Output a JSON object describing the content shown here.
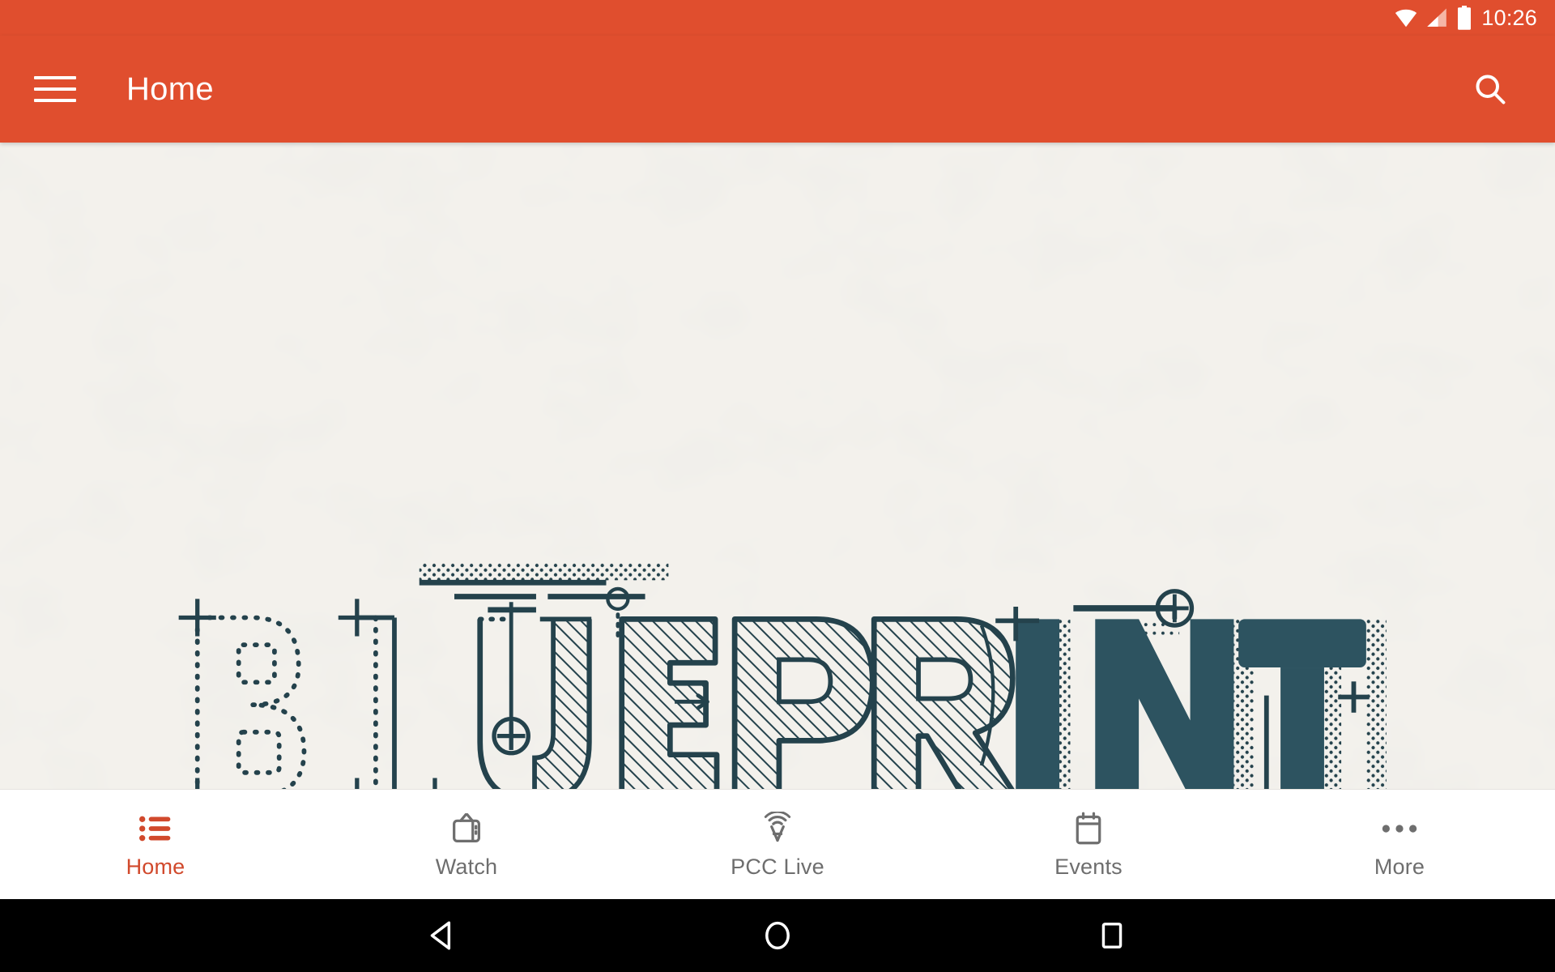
{
  "statusbar": {
    "clock": "10:26",
    "icons": [
      "wifi-icon",
      "cellular-signal-icon",
      "battery-icon"
    ]
  },
  "appbar": {
    "title": "Home",
    "menu_icon": "hamburger-menu-icon",
    "search_icon": "search-icon",
    "background_color": "#e04e2e",
    "title_color": "#ffffff"
  },
  "hero": {
    "artwork_word": "BLUEPRINT",
    "background_color": "#f3f1ec",
    "ink_color": "#24424c",
    "letters": [
      {
        "char": "B",
        "style": "dotted-outline"
      },
      {
        "char": "L",
        "style": "thin-line"
      },
      {
        "char": "U",
        "style": "outline-hatch"
      },
      {
        "char": "E",
        "style": "hatched"
      },
      {
        "char": "P",
        "style": "hatched"
      },
      {
        "char": "R",
        "style": "hatched"
      },
      {
        "char": "I",
        "style": "solid"
      },
      {
        "char": "N",
        "style": "solid-halftone"
      },
      {
        "char": "T",
        "style": "solid-halftone"
      }
    ]
  },
  "bottomnav": {
    "active_color": "#d1492c",
    "inactive_color": "#6e6e6e",
    "items": [
      {
        "label": "Home",
        "icon": "bulleted-list-icon",
        "active": true
      },
      {
        "label": "Watch",
        "icon": "television-icon",
        "active": false
      },
      {
        "label": "PCC Live",
        "icon": "broadcast-tower-icon",
        "active": false
      },
      {
        "label": "Events",
        "icon": "calendar-icon",
        "active": false
      },
      {
        "label": "More",
        "icon": "overflow-dots-icon",
        "active": false
      }
    ]
  },
  "sysnav": {
    "buttons": [
      {
        "name": "back-button",
        "icon": "triangle-back-icon"
      },
      {
        "name": "home-button",
        "icon": "circle-home-icon"
      },
      {
        "name": "recents-button",
        "icon": "square-recents-icon"
      }
    ]
  }
}
